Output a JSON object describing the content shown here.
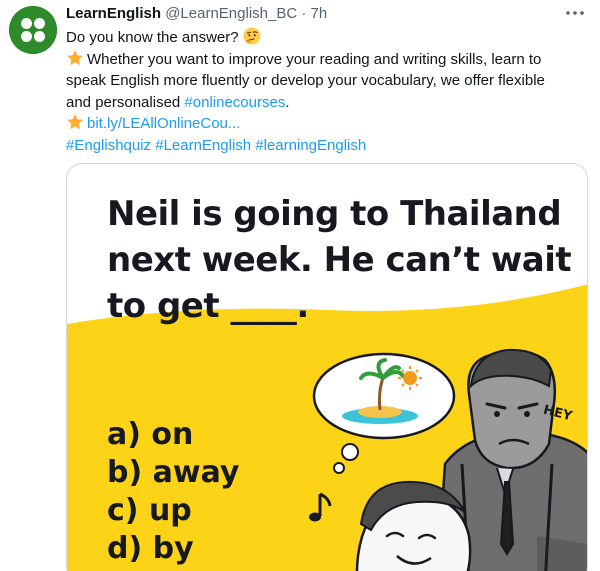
{
  "tweet": {
    "author_name": "LearnEnglish",
    "handle": "@LearnEnglish_BC",
    "separator": "·",
    "time": "7h",
    "lines": {
      "l1": "Do you know the answer?",
      "l2": "Whether you want to improve your reading and writing skills, learn to",
      "l3": "speak English more fluently or develop your vocabulary, we offer flexible",
      "l4_text": "and personalised ",
      "l4_tag": "#onlinecourses",
      "l4_end": ".",
      "l5_link": "bit.ly/LEAllOnlineCou...",
      "l6_tags": "#Englishquiz #LearnEnglish #learningEnglish"
    },
    "icons": {
      "avatar": "british-council-dots-logo",
      "thinking": "thinking-face-emoji",
      "star": "star-emoji",
      "more": "more-options-icon"
    }
  },
  "card": {
    "question_line1": "Neil is going to Thailand",
    "question_line2": "next week. He can’t wait",
    "question_line3": "to get ____.",
    "options": [
      "a) on",
      "b) away",
      "c) up",
      "d) by"
    ],
    "speech": "HEY",
    "colors": {
      "accent_yellow": "#fdd318",
      "text_dark": "#161a20"
    }
  }
}
